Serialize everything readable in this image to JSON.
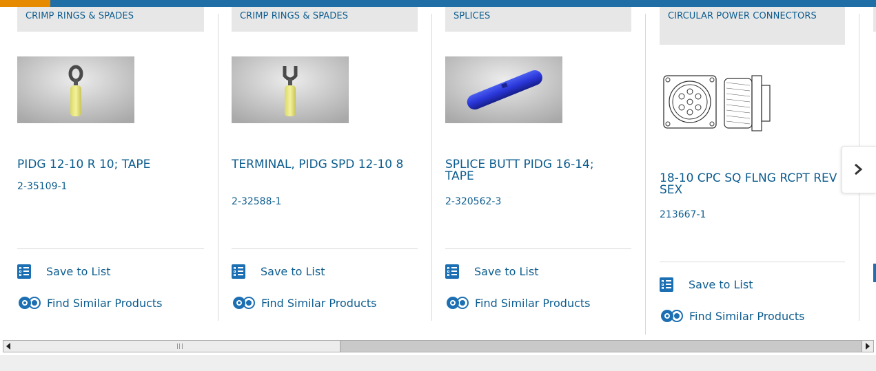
{
  "products": [
    {
      "category": "CRIMP RINGS & SPADES",
      "name": "PIDG 12-10 R 10; TAPE",
      "part_number": "2-35109-1",
      "save_label": "Save to List",
      "similar_label": "Find Similar Products",
      "image": "ring-terminal-image"
    },
    {
      "category": "CRIMP RINGS & SPADES",
      "name": "TERMINAL, PIDG SPD 12-10 8",
      "part_number": "2-32588-1",
      "save_label": "Save to List",
      "similar_label": "Find Similar Products",
      "image": "spade-terminal-image"
    },
    {
      "category": "SPLICES",
      "name": "SPLICE BUTT PIDG 16-14; TAPE",
      "part_number": "2-320562-3",
      "save_label": "Save to List",
      "similar_label": "Find Similar Products",
      "image": "butt-splice-image"
    },
    {
      "category": "CIRCULAR POWER CONNECTORS",
      "name": "18-10 CPC SQ FLNG RCPT REV SEX",
      "part_number": "213667-1",
      "save_label": "Save to List",
      "similar_label": "Find Similar Products",
      "image": "circular-connector-drawing"
    }
  ],
  "carousel": {
    "next_icon": "chevron-right-icon"
  },
  "colors": {
    "link": "#0d5d8f",
    "category_bg": "#e7e7e7",
    "top_bar": "#1f6ea5",
    "top_accent": "#e68a00",
    "icon_blue": "#1c6fb2"
  }
}
